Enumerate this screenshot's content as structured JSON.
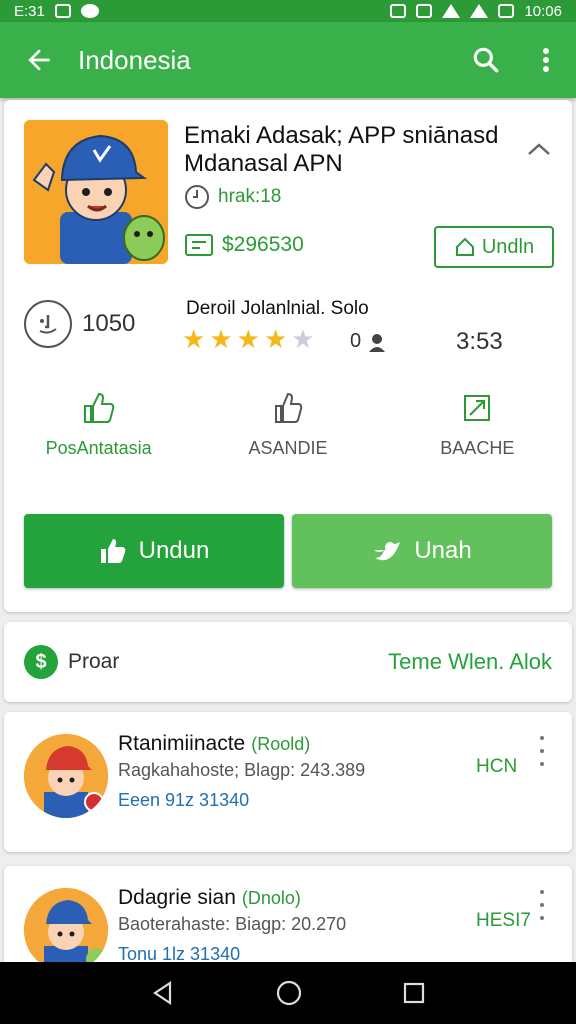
{
  "status_bar": {
    "time_left": "E:31",
    "time_right": "10:06"
  },
  "app_bar": {
    "title": "Indonesia"
  },
  "app": {
    "title": "Emaki Adasak; APP sniānasd Mdanasal APN",
    "time_label": "hrak:18",
    "price": "$296530",
    "install_label": "Undln",
    "rating_count": "1050",
    "detail_title": "Deroil Jolanlnial. Solo",
    "rating_value": 4,
    "rating_max": 5,
    "review_count": "0",
    "duration": "3:53"
  },
  "actions": [
    {
      "label": "PosAntatasia"
    },
    {
      "label": "ASANDIE"
    },
    {
      "label": "BAACHE"
    }
  ],
  "buttons": {
    "download": "Undun",
    "share": "Unah"
  },
  "promo": {
    "label": "Proar",
    "link": "Teme Wlen. Alok"
  },
  "items": [
    {
      "title": "Rtanimiinacte",
      "tag": "(Roold)",
      "subtitle": "Ragkahahoste; Blagp: 243.389",
      "price": "Eeen 91z 31340",
      "badge": "HCN"
    },
    {
      "title": "Ddagrie sian",
      "tag": "(Dnolo)",
      "subtitle": "Baoterahaste: Biagp: 20.270",
      "price": "Tonu 1lz 31340",
      "badge": "HESI7"
    }
  ],
  "colors": {
    "brand_green": "#3ab04a",
    "dark_green": "#2c9a37",
    "star": "#f5b81c"
  }
}
